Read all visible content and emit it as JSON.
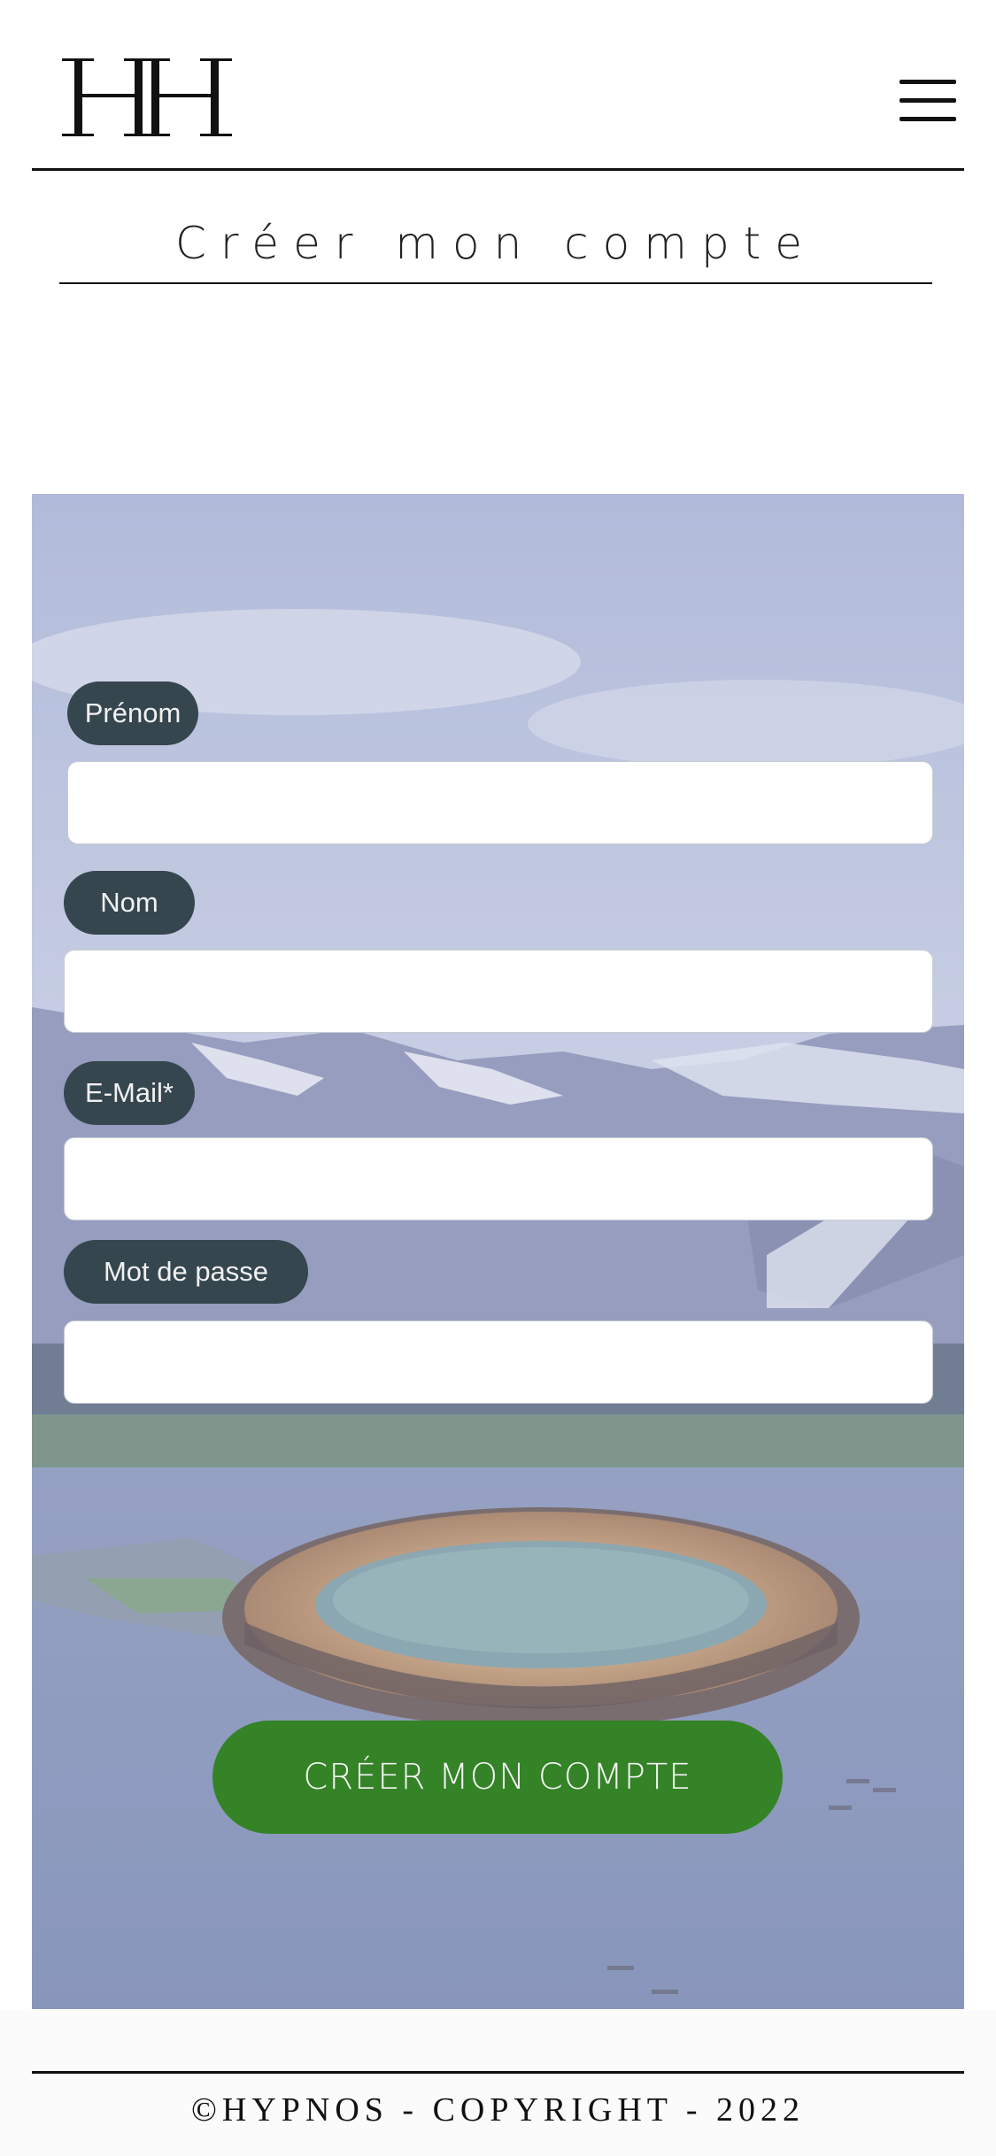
{
  "header": {
    "logo_alt": "HH",
    "menu_icon": "hamburger-menu-icon"
  },
  "page": {
    "title": "Créer mon compte"
  },
  "form": {
    "fields": [
      {
        "label": "Prénom",
        "value": "",
        "placeholder": ""
      },
      {
        "label": "Nom",
        "value": "",
        "placeholder": ""
      },
      {
        "label": "E-Mail*",
        "value": "",
        "placeholder": ""
      },
      {
        "label": "Mot de passe",
        "value": "",
        "placeholder": ""
      }
    ],
    "submit_label": "CRÉER MON COMPTE"
  },
  "hero": {
    "image": "hotel-ring-on-fjord-photo"
  },
  "footer": {
    "copyright": "©HYPNOS - COPYRIGHT - 2022"
  },
  "colors": {
    "label_bg": "#36464f",
    "submit_bg": "#348327",
    "rule": "#111111",
    "overlay": "#b7bfdc"
  }
}
